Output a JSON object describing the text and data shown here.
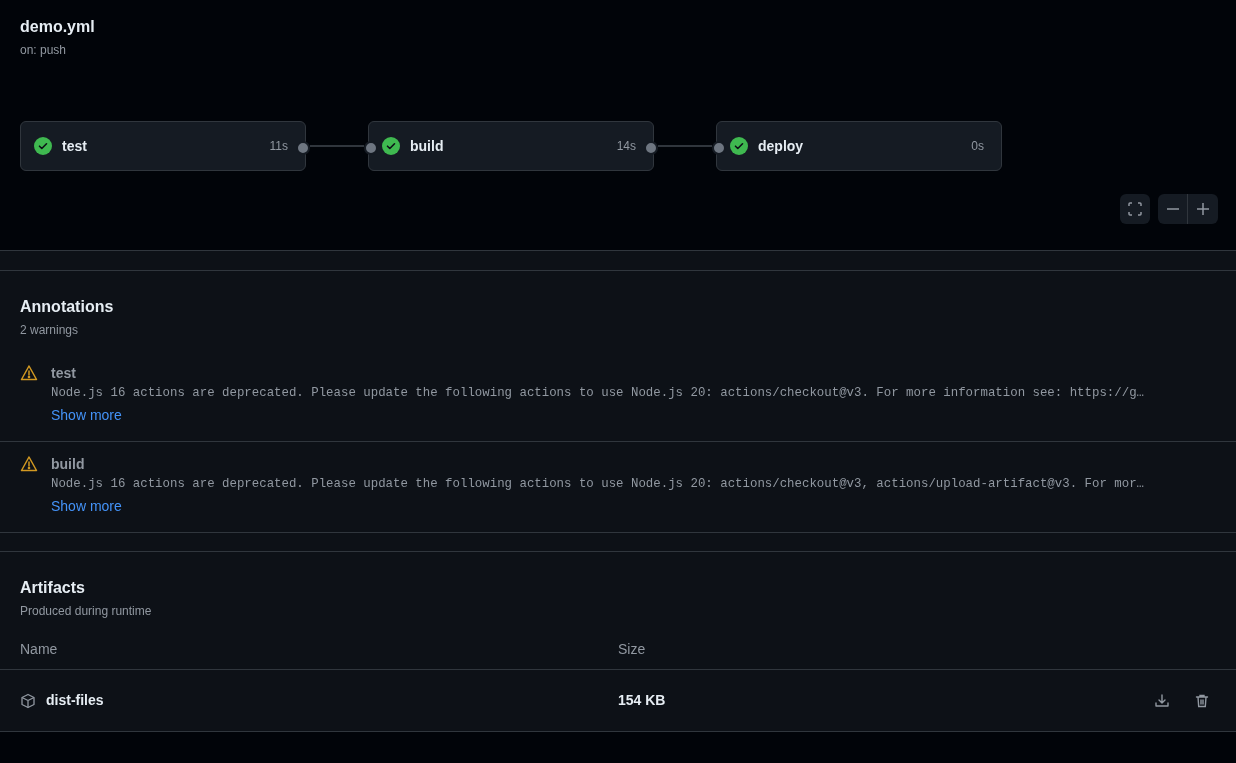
{
  "workflow": {
    "title": "demo.yml",
    "trigger": "on: push"
  },
  "jobs": [
    {
      "name": "test",
      "duration": "11s",
      "kind": "success"
    },
    {
      "name": "build",
      "duration": "14s",
      "kind": "success"
    },
    {
      "name": "deploy",
      "duration": "0s",
      "kind": "success"
    }
  ],
  "annotations": {
    "title": "Annotations",
    "subtitle": "2 warnings",
    "items": [
      {
        "kind": "warning",
        "job": "test",
        "message": "Node.js 16 actions are deprecated. Please update the following actions to use Node.js 20: actions/checkout@v3. For more information see: https://g…",
        "link": "Show more"
      },
      {
        "kind": "warning",
        "job": "build",
        "message": "Node.js 16 actions are deprecated. Please update the following actions to use Node.js 20: actions/checkout@v3, actions/upload-artifact@v3. For mor…",
        "link": "Show more"
      }
    ]
  },
  "artifacts": {
    "title": "Artifacts",
    "subtitle": "Produced during runtime",
    "columns": [
      "Name",
      "Size"
    ],
    "rows": [
      {
        "name": "dist-files",
        "size": "154 KB"
      }
    ]
  }
}
